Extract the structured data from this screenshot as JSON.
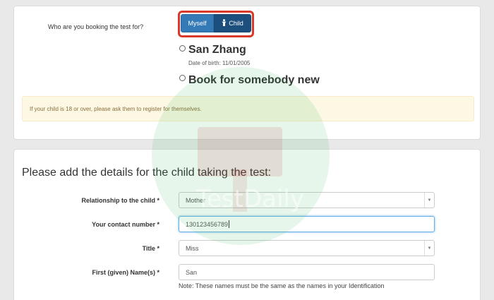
{
  "booking": {
    "question": "Who are you booking the test for?",
    "option_myself": "Myself",
    "option_child": "Child",
    "selected_option": "Child",
    "existing_child": {
      "name": "San Zhang",
      "dob_text": "Date of birth: 11/01/2005"
    },
    "new_person_label": "Book for somebody new",
    "alert_text": "If your child is 18 or over, please ask them to register for themselves."
  },
  "details": {
    "heading": "Please add the details for the child taking the test:",
    "relationship": {
      "label": "Relationship to the child *",
      "value": "Mother"
    },
    "contact": {
      "label": "Your contact number *",
      "value": "130123456789"
    },
    "title": {
      "label": "Title *",
      "value": "Miss"
    },
    "first_name": {
      "label": "First (given) Name(s) *",
      "value": "San"
    },
    "note": "Note: These names must be the same as the names in your Identification"
  },
  "watermark": {
    "text": "TestDaily",
    "color": "#2fb34f"
  },
  "icons": {
    "child_icon": "child-figure-icon",
    "select_caret": "caret-down-icon"
  },
  "colors": {
    "primary": "#337ab7",
    "active": "#1c4f7d",
    "highlight": "#d8392b",
    "alert_bg": "#fcf8e3",
    "focus": "#66afe9"
  }
}
